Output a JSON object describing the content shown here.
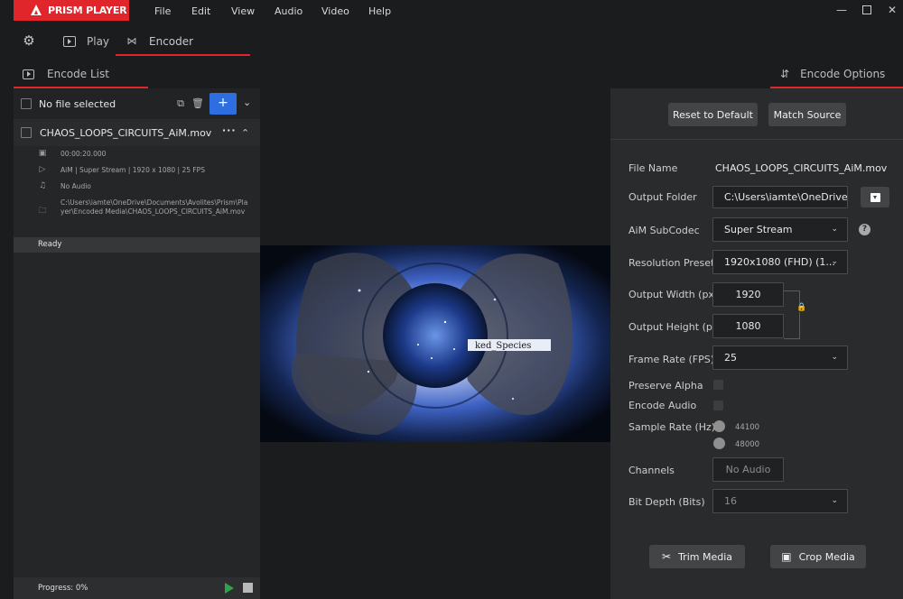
{
  "app": {
    "logo_text": "PRISM PLAYER"
  },
  "menu": [
    {
      "label": "File"
    },
    {
      "label": "Edit"
    },
    {
      "label": "View"
    },
    {
      "label": "Audio"
    },
    {
      "label": "Video"
    },
    {
      "label": "Help"
    }
  ],
  "modes": {
    "play": "Play",
    "encoder": "Encoder"
  },
  "subtabs": {
    "encode_list": "Encode List",
    "encode_options": "Encode Options"
  },
  "encode_list": {
    "header_label": "No file selected",
    "file": {
      "name": "CHAOS_LOOPS_CIRCUITS_AiM.mov",
      "duration": "00:00:20.000",
      "video_info": "AiM | Super Stream | 1920 x 1080 | 25 FPS",
      "audio_info": "No Audio",
      "output_path": "C:\\Users\\iamte\\OneDrive\\Documents\\Avolites\\Prism\\Player\\Encoded Media\\CHAOS_LOOPS_CIRCUITS_AiM.mov",
      "status": "Ready"
    },
    "progress_label": "Progress: 0%",
    "progress": 0
  },
  "preview": {
    "overlay_text": "ked_Species"
  },
  "options": {
    "reset_button": "Reset to Default",
    "match_button": "Match Source",
    "file_name_label": "File Name",
    "file_name_value": "CHAOS_LOOPS_CIRCUITS_AiM.mov",
    "output_folder_label": "Output Folder",
    "output_folder_value": "C:\\Users\\iamte\\OneDrive\\D",
    "subcodec_label": "AiM SubCodec",
    "subcodec_value": "Super Stream",
    "resolution_label": "Resolution Preset",
    "resolution_value": "1920x1080 (FHD) (1...",
    "width_label": "Output Width (px)",
    "width_value": "1920",
    "height_label": "Output Height (px)",
    "height_value": "1080",
    "framerate_label": "Frame Rate (FPS)",
    "framerate_value": "25",
    "preserve_alpha_label": "Preserve Alpha",
    "encode_audio_label": "Encode Audio",
    "sample_rate_label": "Sample Rate (Hz)",
    "sample_rate_options": [
      "44100",
      "48000"
    ],
    "channels_label": "Channels",
    "channels_value": "No Audio",
    "bit_depth_label": "Bit Depth (Bits)",
    "bit_depth_value": "16",
    "trim_button": "Trim Media",
    "crop_button": "Crop Media"
  },
  "colors": {
    "accent_red": "#e0252b",
    "accent_blue": "#2d6fe0",
    "play_green": "#2fa34a"
  }
}
